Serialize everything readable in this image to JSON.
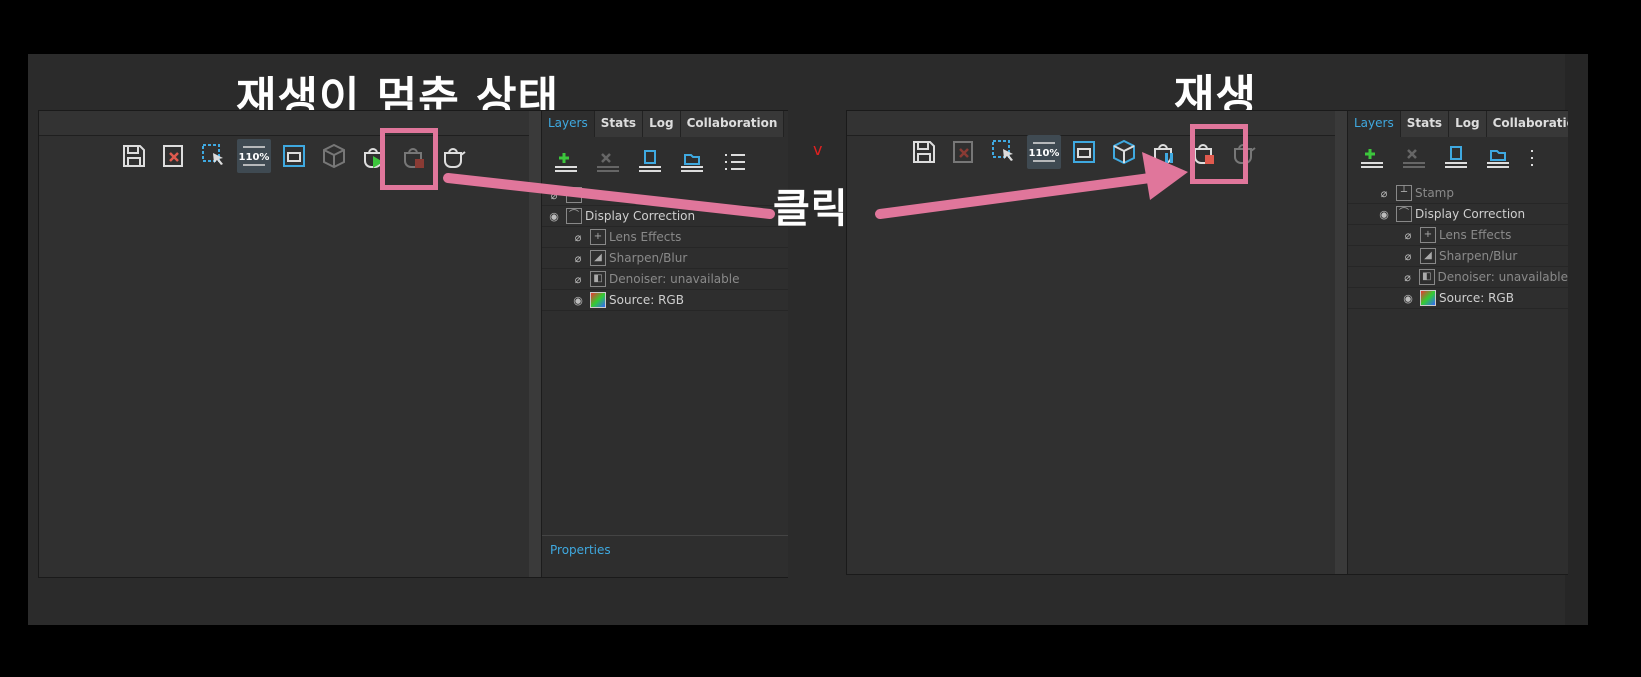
{
  "captions": {
    "left": "재생이 멈춘 상태",
    "right": "재생",
    "click": "클릭"
  },
  "panel_tabs": [
    {
      "label": "Layers"
    },
    {
      "label": "Stats"
    },
    {
      "label": "Log"
    },
    {
      "label": "Collaboration"
    }
  ],
  "left_window": {
    "layers": [
      {
        "label": "Display Correction",
        "visible": true,
        "icon": "curve-icon"
      },
      {
        "label": "Lens Effects",
        "visible": false,
        "icon": "crosshair-icon"
      },
      {
        "label": "Sharpen/Blur",
        "visible": false,
        "icon": "sharpen-icon"
      },
      {
        "label": "Denoiser: unavailable",
        "visible": false,
        "icon": "denoise-icon"
      },
      {
        "label": "Source: RGB",
        "visible": true,
        "icon": "rgb-icon"
      }
    ],
    "properties_tab": "Properties",
    "render_state": "stopped"
  },
  "right_window": {
    "layers": [
      {
        "label": "Stamp",
        "visible": false,
        "icon": "stamp-icon"
      },
      {
        "label": "Display Correction",
        "visible": true,
        "icon": "curve-icon"
      },
      {
        "label": "Lens Effects",
        "visible": false,
        "icon": "crosshair-icon"
      },
      {
        "label": "Sharpen/Blur",
        "visible": false,
        "icon": "sharpen-icon"
      },
      {
        "label": "Denoiser: unavailable",
        "visible": false,
        "icon": "denoise-icon"
      },
      {
        "label": "Source: RGB",
        "visible": true,
        "icon": "rgb-icon"
      }
    ],
    "render_state": "playing"
  },
  "toolbar": {
    "zoom_label": "110%",
    "icons": [
      "save-icon",
      "clear-icon",
      "region-select-icon",
      "zoom-icon",
      "frame-icon",
      "cube-icon",
      "render-teapot-icon",
      "stop-teapot-icon",
      "teapot-icon"
    ]
  },
  "colors": {
    "highlight": "#e0769b",
    "accent": "#3fa9e0",
    "play_green": "#3cc63c",
    "stop_red": "#e05a4e"
  },
  "annotation_mark": "v"
}
